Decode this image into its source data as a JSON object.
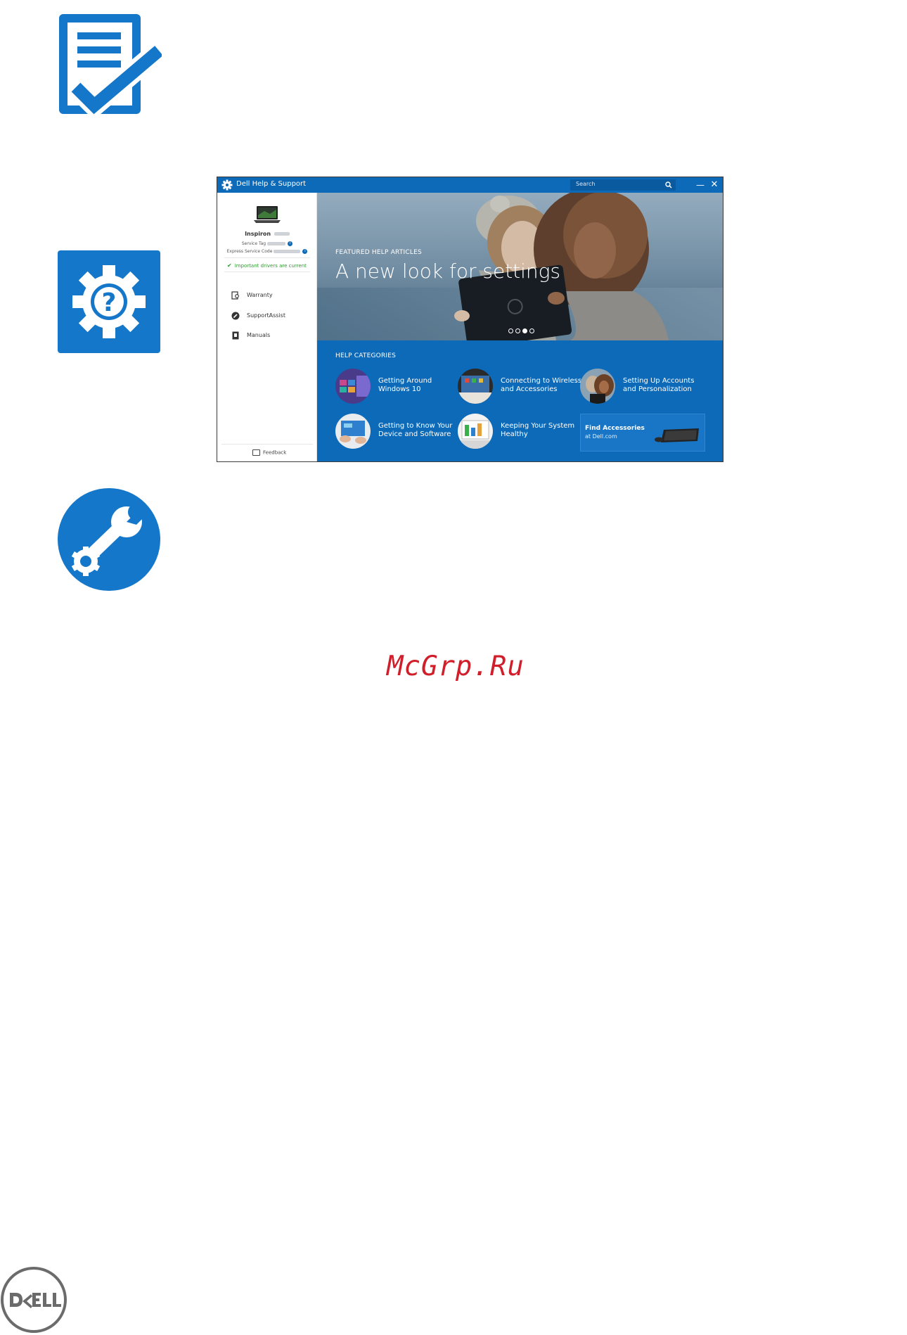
{
  "window": {
    "title": "Dell Help & Support",
    "search_placeholder": "Search",
    "minimize_label": "—",
    "close_label": "✕"
  },
  "sidebar": {
    "device_name": "Inspiron",
    "service_tag_label": "Service Tag",
    "express_code_label": "Express Service Code",
    "info_glyph": "i",
    "drivers_status": "Important drivers are current",
    "nav": [
      {
        "label": "Warranty"
      },
      {
        "label": "SupportAssist"
      },
      {
        "label": "Manuals"
      }
    ],
    "feedback_label": "Feedback"
  },
  "hero": {
    "featured_label": "FEATURED HELP ARTICLES",
    "title": "A new look for settings",
    "carousel_active_index": 3,
    "carousel_count": 4
  },
  "categories": {
    "heading": "HELP CATEGORIES",
    "items": [
      {
        "line1": "Getting Around",
        "line2": "Windows 10"
      },
      {
        "line1": "Connecting to Wireless",
        "line2": "and Accessories"
      },
      {
        "line1": "Setting Up Accounts",
        "line2": "and Personalization"
      },
      {
        "line1": "Getting to Know Your",
        "line2": "Device and Software"
      },
      {
        "line1": "Keeping Your System",
        "line2": "Healthy"
      }
    ],
    "accessories": {
      "title": "Find Accessories",
      "subtitle": "at Dell.com"
    }
  },
  "watermark": "McGrp.Ru",
  "colors": {
    "dell_blue": "#0c6ab8",
    "icon_blue": "#1577c9",
    "watermark_red": "#d01f2a"
  },
  "icons": [
    "checklist-icon",
    "help-gear-icon",
    "support-wrench-icon",
    "dell-logo"
  ]
}
